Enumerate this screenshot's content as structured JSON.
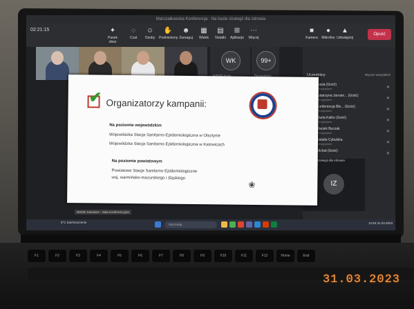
{
  "scene": {
    "date_stamp": "31.03.2023"
  },
  "teams": {
    "timer": "02:21:15",
    "window_title": "Marszałkowska Konferencja - Na bazie strategii dla zdrowia",
    "toolbar": [
      {
        "label": "Pasek obso",
        "icon": "rocket-icon"
      },
      {
        "label": "Czat",
        "icon": "chat-icon"
      },
      {
        "label": "Osoby",
        "icon": "people-icon"
      },
      {
        "label": "Podniesiony",
        "icon": "hand-icon"
      },
      {
        "label": "Zareaguj",
        "icon": "smile-icon"
      },
      {
        "label": "Widok",
        "icon": "grid-icon"
      },
      {
        "label": "Notatki",
        "icon": "notes-icon"
      },
      {
        "label": "Aplikacje",
        "icon": "apps-icon"
      },
      {
        "label": "Więcej",
        "icon": "more-icon"
      },
      {
        "label": "Kamera",
        "icon": "camera-icon"
      },
      {
        "label": "Mikrofon",
        "icon": "mic-icon"
      },
      {
        "label": "Udostępnij",
        "icon": "share-icon"
      }
    ],
    "leave_label": "Opuść",
    "tiles": [
      {
        "initials": "WK",
        "label": "WSSE Kato..."
      },
      {
        "initials": "99+",
        "label": "Dozwolony"
      }
    ],
    "panel_tile_initials": "WK",
    "panel_header": "Uczestnicy",
    "panel_header_right": "Wycisz wszystkich",
    "participants": [
      {
        "name": "Kasia (Gość)",
        "sub": "Nieoglądane"
      },
      {
        "name": "Katarzyna Jarosie... (Gość)",
        "sub": "Nieoglądane"
      },
      {
        "name": "Konferencja Ble... (Gość)",
        "sub": "Nieoglądane"
      },
      {
        "name": "Marta Kalko (Gość)",
        "sub": "Nieoglądane"
      },
      {
        "name": "Maciek Buczak",
        "sub": "Nieoglądane"
      },
      {
        "name": "Natalia Cybulska",
        "sub": "Nieoglądane"
      },
      {
        "name": "Michał (Gość)",
        "sub": "Nieoglądane"
      }
    ],
    "iz_initials": "IZ",
    "iz_caption": "Na bazie strategii dla zdrowia",
    "slide_caption": "WSSE Katowice - Sala Konferencyjna",
    "weather": "6°C Zachmurzenie",
    "search_placeholder": "Wyszukaj",
    "clock": "12:53 31.03.2023"
  },
  "slide": {
    "title": "Organizatorzy kampanii:",
    "section1_head": "Na poziomie wojewódzkim",
    "section1_lines": [
      "Wojewódzka Stacja Sanitarno-Epidemiologiczna w Olsztynie",
      "Wojewódzka Stacja Sanitarno-Epidemiologiczna w Katowicach"
    ],
    "section2_head": "Na poziomie powiatowym",
    "section2_lines": [
      "Powiatowe Stacje Sanitarno-Epidemiologiczne",
      "woj. warmińsko-mazurskiego i śląskiego"
    ]
  },
  "colors": {
    "leave": "#c4314b",
    "check": "#2e9b2e",
    "box": "#c0392b",
    "date_stamp": "#ffa24a"
  }
}
